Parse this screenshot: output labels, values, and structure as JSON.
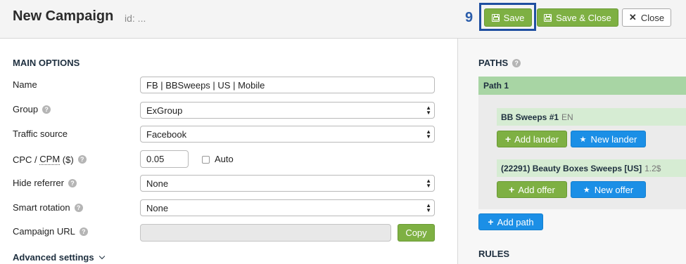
{
  "header": {
    "title": "New Campaign",
    "id_text": "id: ...",
    "step_number": "9",
    "save_label": "Save",
    "save_close_label": "Save & Close",
    "close_label": "Close"
  },
  "main": {
    "section_title": "MAIN OPTIONS",
    "fields": {
      "name": {
        "label": "Name",
        "value": "FB | BBSweeps | US | Mobile"
      },
      "group": {
        "label": "Group",
        "value": "ExGroup"
      },
      "traffic_source": {
        "label": "Traffic source",
        "value": "Facebook"
      },
      "cpc": {
        "label_cpc": "CPC / ",
        "label_cpm": "CPM",
        "label_unit": " ($)",
        "value": "0.05",
        "auto_label": "Auto"
      },
      "hide_referrer": {
        "label": "Hide referrer",
        "value": "None"
      },
      "smart_rotation": {
        "label": "Smart rotation",
        "value": "None"
      },
      "campaign_url": {
        "label": "Campaign URL",
        "value": "",
        "copy_label": "Copy"
      }
    },
    "advanced_settings_label": "Advanced settings"
  },
  "paths": {
    "section_title": "PATHS",
    "path1": {
      "label": "Path 1",
      "lander_group": {
        "name": "BB Sweeps #1",
        "lang": "EN"
      },
      "add_lander_label": "Add lander",
      "new_lander_label": "New lander",
      "offer_group": {
        "name": "(22291) Beauty Boxes Sweeps [US]",
        "payout": "1.2$"
      },
      "add_offer_label": "Add offer",
      "new_offer_label": "New offer"
    },
    "add_path_label": "Add path"
  },
  "rules": {
    "section_title": "RULES"
  },
  "colors": {
    "accent_green": "#7eb043",
    "accent_blue": "#1b8fe6",
    "highlight": "#1f4fa0",
    "path_header": "#a8d5a4"
  }
}
